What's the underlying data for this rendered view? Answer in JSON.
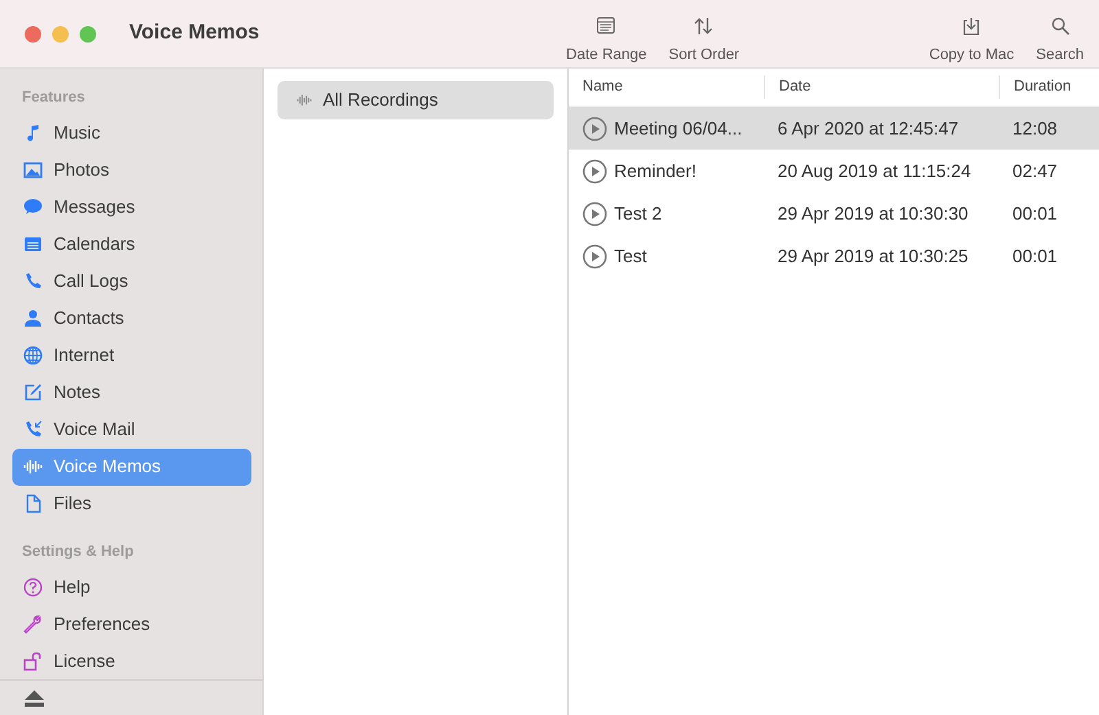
{
  "window": {
    "title": "Voice Memos"
  },
  "toolbar": {
    "left": [
      {
        "label": "Date Range"
      },
      {
        "label": "Sort Order"
      }
    ],
    "right": [
      {
        "label": "Copy to Mac"
      },
      {
        "label": "Search"
      }
    ]
  },
  "sidebar": {
    "sections": [
      {
        "title": "Features",
        "items": [
          {
            "label": "Music",
            "selected": false
          },
          {
            "label": "Photos",
            "selected": false
          },
          {
            "label": "Messages",
            "selected": false
          },
          {
            "label": "Calendars",
            "selected": false
          },
          {
            "label": "Call Logs",
            "selected": false
          },
          {
            "label": "Contacts",
            "selected": false
          },
          {
            "label": "Internet",
            "selected": false
          },
          {
            "label": "Notes",
            "selected": false
          },
          {
            "label": "Voice Mail",
            "selected": false
          },
          {
            "label": "Voice Memos",
            "selected": true
          },
          {
            "label": "Files",
            "selected": false
          }
        ]
      },
      {
        "title": "Settings & Help",
        "items": [
          {
            "label": "Help",
            "selected": false
          },
          {
            "label": "Preferences",
            "selected": false
          },
          {
            "label": "License",
            "selected": false
          }
        ]
      }
    ]
  },
  "folders": [
    {
      "label": "All Recordings",
      "selected": true
    }
  ],
  "table": {
    "columns": [
      "Name",
      "Date",
      "Duration"
    ],
    "rows": [
      {
        "name": "Meeting 06/04...",
        "date": "6 Apr 2020 at 12:45:47",
        "duration": "12:08",
        "selected": true
      },
      {
        "name": "Reminder!",
        "date": "20 Aug 2019 at 11:15:24",
        "duration": "02:47",
        "selected": false
      },
      {
        "name": "Test 2",
        "date": "29 Apr 2019 at 10:30:30",
        "duration": "00:01",
        "selected": false
      },
      {
        "name": "Test",
        "date": "29 Apr 2019 at 10:30:25",
        "duration": "00:01",
        "selected": false
      }
    ]
  }
}
